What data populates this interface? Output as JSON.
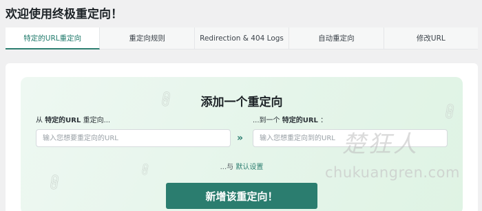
{
  "page": {
    "title": "欢迎使用终极重定向！"
  },
  "tabs": [
    {
      "label": "特定的URL重定向",
      "active": true
    },
    {
      "label": "重定向规则",
      "active": false
    },
    {
      "label": "Redirection & 404 Logs",
      "active": false
    },
    {
      "label": "自动重定向",
      "active": false
    },
    {
      "label": "修改URL",
      "active": false
    }
  ],
  "form": {
    "title": "添加一个重定向",
    "from_label": {
      "prefix": "从",
      "strong": "特定的URL",
      "suffix": "重定向..."
    },
    "to_label": {
      "prefix": "...到一个",
      "strong": "特定的URL",
      "suffix": "："
    },
    "from_placeholder": "输入您想要重定向的URL",
    "to_placeholder": "输入您想重定向到的URL",
    "arrows": "»",
    "defaults_prefix": "...与",
    "defaults_link": "默认设置",
    "submit_label": "新增该重定向！"
  },
  "watermark": {
    "script": "楚狂人",
    "url": "chukuangren.com"
  },
  "icons": {
    "decoration": "link-icon"
  },
  "colors": {
    "accent": "#2b7d6f",
    "panel_bg": "#e5f5ea",
    "page_bg": "#f0f0f1"
  }
}
